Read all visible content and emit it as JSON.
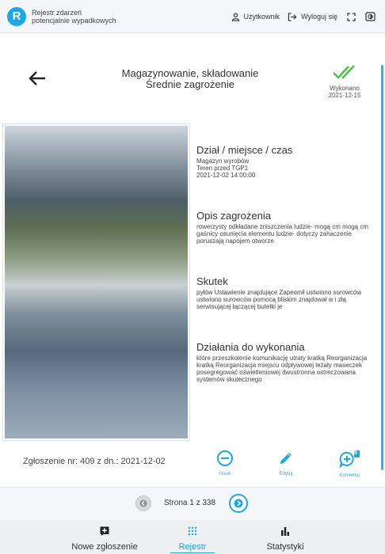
{
  "header": {
    "app_title_line1": "Rejestr zdarzeń",
    "app_title_line2": "potencjalnie wypadkowych",
    "logo_letter": "R",
    "user_label": "Użytkownik",
    "logout_label": "Wyloguj się"
  },
  "incident": {
    "title_line1": "Magazynowanie, składowanie",
    "title_line2": "Średnie zagrożenie",
    "status_label": "Wykonano",
    "status_date": "2021-12-15",
    "status_color": "#49c23f"
  },
  "sections": {
    "location": {
      "title": "Dział / miejsce / czas",
      "line1": "Magazyn wyrobów",
      "line2": "Teren przed TGP1",
      "line3": "2021-12-02 14:00:00"
    },
    "hazard": {
      "title": "Opis zagrożenia",
      "text": "rowerzysty odkładane zniszczenia ludzie- mogą cm mogą cm gaśnicy osunięcia elementu ludzie- dotyczy zahaczenie poruszają napojem otworze"
    },
    "effect": {
      "title": "Skutek",
      "text": "pyłów Ustawienie znajdujące Zapewnił ustwiono surowców ustwiono surowców pomocą bliskim znajdował w i złą serwisującej łączącej butelki je"
    },
    "actions": {
      "title": "Działania do wykonania",
      "text": "które przeszkolenie komunikację utraty kratką Reorganizacja kratką Reorganizacja miejscu odpływowej leżały maseczek posegregować oświetleniowej dwustronna ostreczowana systemów skutecznego"
    }
  },
  "footer": {
    "report_number": "Zgłoszenie nr: 409 z dn.: 2021-12-02",
    "delete_label": "Usuń",
    "edit_label": "Edytuj",
    "comment_label": "Komentuj",
    "comment_count": "0"
  },
  "pager": {
    "text": "Strona 1 z 338"
  },
  "nav": {
    "new_label": "Nowe zgłoszenie",
    "register_label": "Rejestr",
    "stats_label": "Statystyki"
  },
  "colors": {
    "accent": "#1aa9e8",
    "success": "#49c23f"
  }
}
